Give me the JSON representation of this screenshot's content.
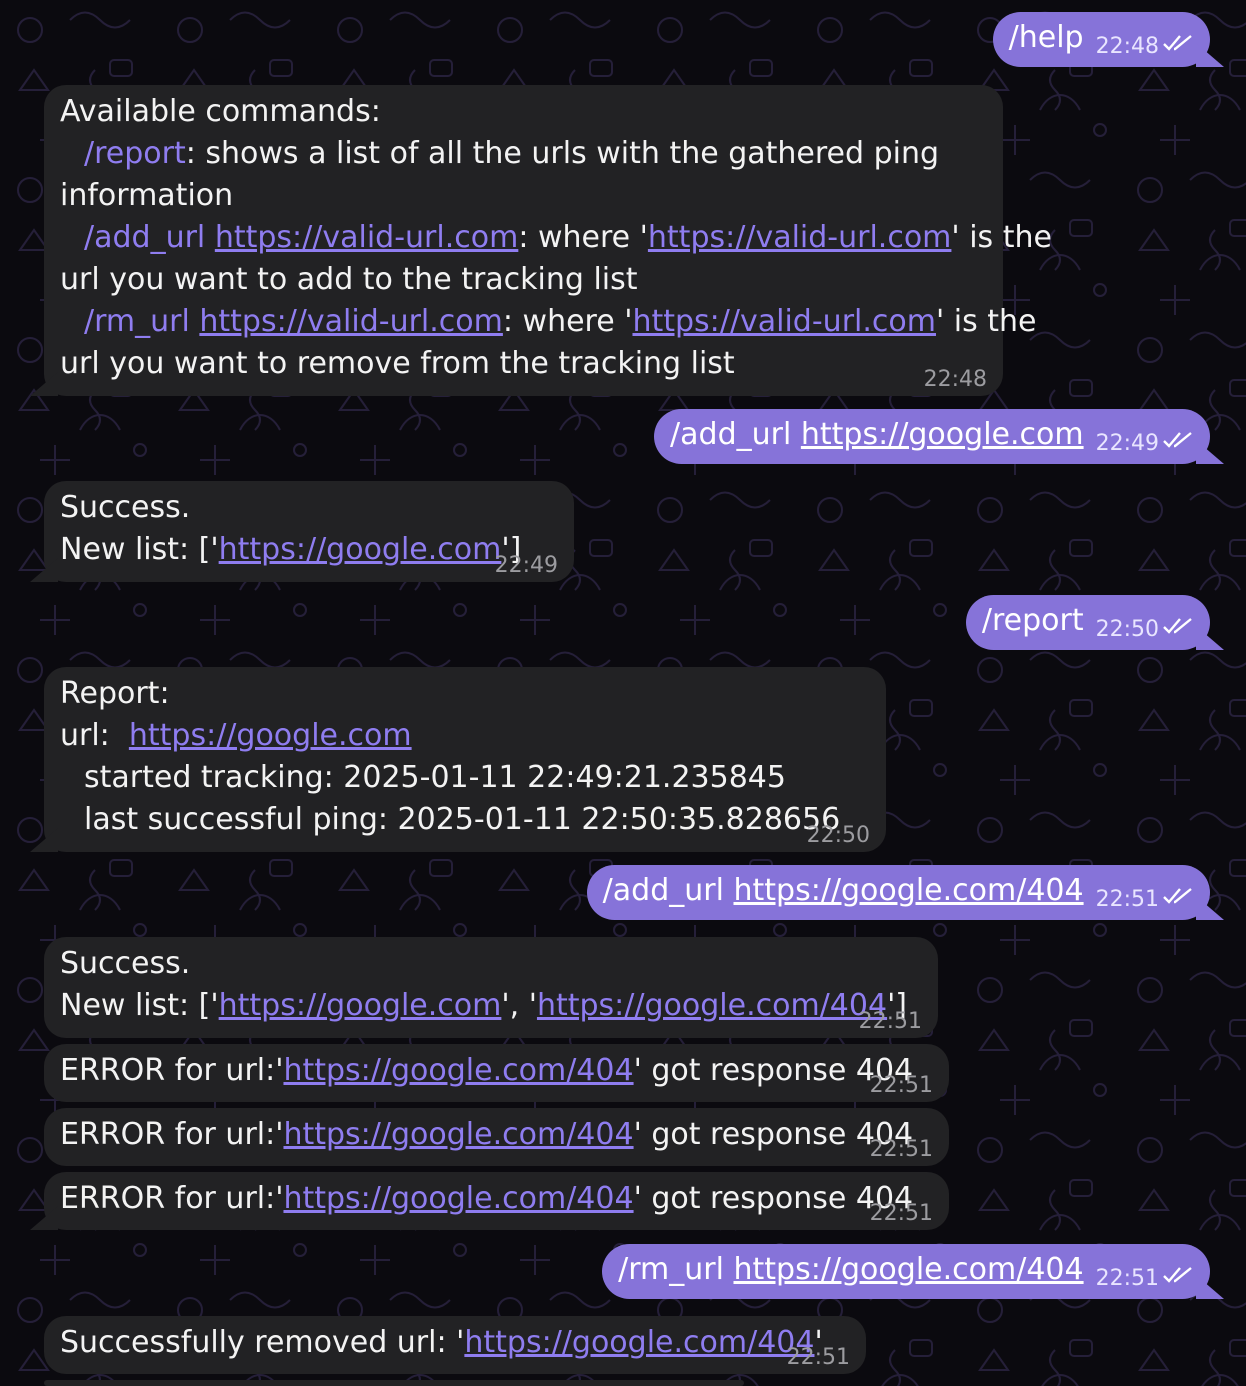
{
  "colors": {
    "background": "#0b0a0f",
    "incoming_bubble": "#222224",
    "outgoing_bubble": "#8673d9",
    "link": "#8f7df0",
    "timestamp": "#9c9ca0"
  },
  "icons": {
    "read_receipt": "double-check-icon"
  },
  "messages": {
    "m1": {
      "text": "/help",
      "time": "22:48"
    },
    "m2": {
      "line1": "Available commands:",
      "l2_cmd": "/report",
      "l2_rest": ": shows a list of all the urls with the gathered ping",
      "line3": "information",
      "l4_cmd": "/add_url",
      "l4_link": "https://valid-url.com",
      "l4_mid": ": where '",
      "l4_link2": "https://valid-url.com",
      "l4_end": "' is the",
      "line5": "url you want to add to the tracking list",
      "l6_cmd": "/rm_url",
      "l6_link": "https://valid-url.com",
      "l6_mid": ": where '",
      "l6_link2": "https://valid-url.com",
      "l6_end": "' is the",
      "line7": "url you want to remove from the tracking list",
      "time": "22:48"
    },
    "m3": {
      "cmd": "/add_url",
      "link": "https://google.com",
      "time": "22:49"
    },
    "m4": {
      "line1": "Success.",
      "l2_pre": "New list: ['",
      "l2_link": "https://google.com",
      "l2_post": "']",
      "time": "22:49"
    },
    "m5": {
      "text": "/report",
      "time": "22:50"
    },
    "m6": {
      "line1": "Report:",
      "l2_label": "url:",
      "l2_link": "https://google.com",
      "line3": "started tracking:  2025-01-11 22:49:21.235845",
      "line4": "last successful ping:  2025-01-11 22:50:35.828656",
      "time": "22:50"
    },
    "m7": {
      "cmd": "/add_url",
      "link": "https://google.com/404",
      "time": "22:51"
    },
    "m8": {
      "line1": "Success.",
      "l2_pre": "New list: ['",
      "l2_link1": "https://google.com",
      "l2_mid": "', '",
      "l2_link2": "https://google.com/404",
      "l2_post": "']",
      "time": "22:51"
    },
    "errors": [
      {
        "pre": "ERROR for url:'",
        "link": "https://google.com/404",
        "post": "' got response 404",
        "time": "22:51"
      },
      {
        "pre": "ERROR for url:'",
        "link": "https://google.com/404",
        "post": "' got response 404",
        "time": "22:51"
      },
      {
        "pre": "ERROR for url:'",
        "link": "https://google.com/404",
        "post": "' got response 404",
        "time": "22:51"
      }
    ],
    "m12": {
      "cmd": "/rm_url",
      "link": "https://google.com/404",
      "time": "22:51"
    },
    "m13": {
      "pre": "Successfully removed url: '",
      "link": "https://google.com/404",
      "post": "'",
      "time": "22:51"
    }
  }
}
